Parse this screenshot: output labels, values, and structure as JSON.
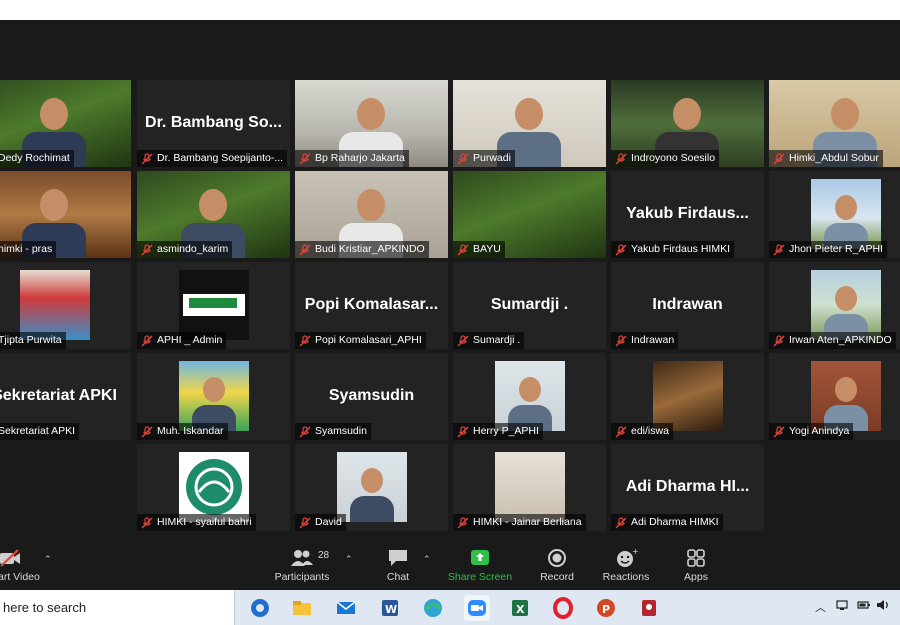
{
  "tiles": [
    {
      "big": "",
      "name": "Dedy Rochimat",
      "bg": "bg-banner",
      "person": true,
      "col": 0,
      "row": 0
    },
    {
      "big": "Dr. Bambang So...",
      "name": "Dr. Bambang Soepijanto-...",
      "bg": "",
      "person": false,
      "col": 1,
      "row": 0
    },
    {
      "big": "",
      "name": "Bp Raharjo Jakarta",
      "bg": "bg-office",
      "person": true,
      "col": 2,
      "row": 0
    },
    {
      "big": "",
      "name": "Purwadi",
      "bg": "bg-room",
      "person": true,
      "col": 3,
      "row": 0
    },
    {
      "big": "",
      "name": "Indroyono Soesilo",
      "bg": "bg-plants",
      "person": true,
      "col": 4,
      "row": 0,
      "active": true
    },
    {
      "big": "",
      "name": "Himki_Abdul Sobur",
      "bg": "bg-beige",
      "person": true,
      "col": 5,
      "row": 0
    },
    {
      "big": "",
      "name": "himki - pras",
      "bg": "bg-mall",
      "person": true,
      "col": 0,
      "row": 1
    },
    {
      "big": "",
      "name": "asmindo_karim",
      "bg": "bg-banner",
      "person": true,
      "col": 1,
      "row": 1
    },
    {
      "big": "",
      "name": "Budi Kristiar_APKINDO",
      "bg": "bg-blur",
      "person": true,
      "col": 2,
      "row": 1
    },
    {
      "big": "",
      "name": "BAYU",
      "bg": "bg-banner",
      "person": false,
      "col": 3,
      "row": 1
    },
    {
      "big": "Yakub Firdaus...",
      "name": "Yakub Firdaus HIMKI",
      "bg": "",
      "person": false,
      "col": 4,
      "row": 1
    },
    {
      "big": "",
      "name": "Jhon Pieter R_APHI",
      "bg": "bg-sky",
      "person": true,
      "col": 5,
      "row": 1,
      "small": true
    },
    {
      "big": "",
      "name": "Tjipta Purwita",
      "bg": "bg-event",
      "person": false,
      "col": 0,
      "row": 2,
      "small": true
    },
    {
      "big": "",
      "name": "APHI _ Admin",
      "bg": "bg-logo-white",
      "person": false,
      "col": 1,
      "row": 2,
      "small": true
    },
    {
      "big": "Popi Komalasar...",
      "name": "Popi Komalasari_APHI",
      "bg": "",
      "person": false,
      "col": 2,
      "row": 2
    },
    {
      "big": "Sumardji .",
      "name": "Sumardji .",
      "bg": "",
      "person": false,
      "col": 3,
      "row": 2
    },
    {
      "big": "Indrawan",
      "name": "Indrawan",
      "bg": "",
      "person": false,
      "col": 4,
      "row": 2
    },
    {
      "big": "",
      "name": "Irwan Aten_APKINDO",
      "bg": "bg-field",
      "person": true,
      "col": 5,
      "row": 2,
      "small": true
    },
    {
      "big": "Sekretariat APKI",
      "name": "Sekretariat APKI",
      "bg": "",
      "person": false,
      "col": 0,
      "row": 3
    },
    {
      "big": "",
      "name": "Muh. Iskandar",
      "bg": "bg-poster",
      "person": true,
      "col": 1,
      "row": 3,
      "small": true
    },
    {
      "big": "Syamsudin",
      "name": "Syamsudin",
      "bg": "",
      "person": false,
      "col": 2,
      "row": 3
    },
    {
      "big": "",
      "name": "Herry P_APHI",
      "bg": "bg-portrait",
      "person": true,
      "col": 3,
      "row": 3,
      "small": true
    },
    {
      "big": "",
      "name": "edi/iswa",
      "bg": "bg-owl",
      "person": false,
      "col": 4,
      "row": 3,
      "small": true
    },
    {
      "big": "",
      "name": "Yogi Anindya",
      "bg": "bg-brick",
      "person": true,
      "col": 5,
      "row": 3,
      "small": true
    },
    {
      "big": "",
      "name": "HIMKI - syaiful bahri",
      "bg": "bg-logo-white",
      "person": false,
      "col": 1,
      "row": 4,
      "small": true,
      "logo": "circle"
    },
    {
      "big": "",
      "name": "David",
      "bg": "bg-portrait",
      "person": true,
      "col": 2,
      "row": 4,
      "small": true
    },
    {
      "big": "",
      "name": "HIMKI - Jainar Berliana",
      "bg": "bg-shelf",
      "person": false,
      "col": 3,
      "row": 4,
      "small": true
    },
    {
      "big": "Adi Dharma HI...",
      "name": "Adi Dharma HIMKI",
      "bg": "",
      "person": false,
      "col": 4,
      "row": 4
    }
  ],
  "toolbar": {
    "start_video": "art Video",
    "participants": "Participants",
    "participants_count": "28",
    "chat": "Chat",
    "share_screen": "Share Screen",
    "record": "Record",
    "reactions": "Reactions",
    "apps": "Apps"
  },
  "taskbar": {
    "search_placeholder": "here to search"
  },
  "colors": {
    "active_speaker": "#a6d63a",
    "share_green": "#2fbf4a",
    "muted_red": "#e0443a"
  }
}
